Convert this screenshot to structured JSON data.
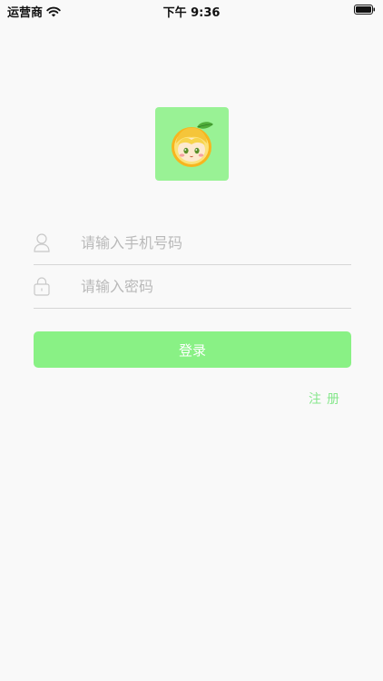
{
  "status_bar": {
    "carrier": "运营商",
    "time": "下午 9:36"
  },
  "colors": {
    "background": "#f9f9f9",
    "accent": "#89f185",
    "logo_bg": "#99f295",
    "register_text": "#86e78c"
  },
  "logo": {
    "icon": "lemon-mascot-icon"
  },
  "form": {
    "phone": {
      "icon": "user-icon",
      "placeholder": "请输入手机号码",
      "value": ""
    },
    "password": {
      "icon": "lock-icon",
      "placeholder": "请输入密码",
      "value": ""
    },
    "login_label": "登录",
    "register_label": "注册"
  }
}
